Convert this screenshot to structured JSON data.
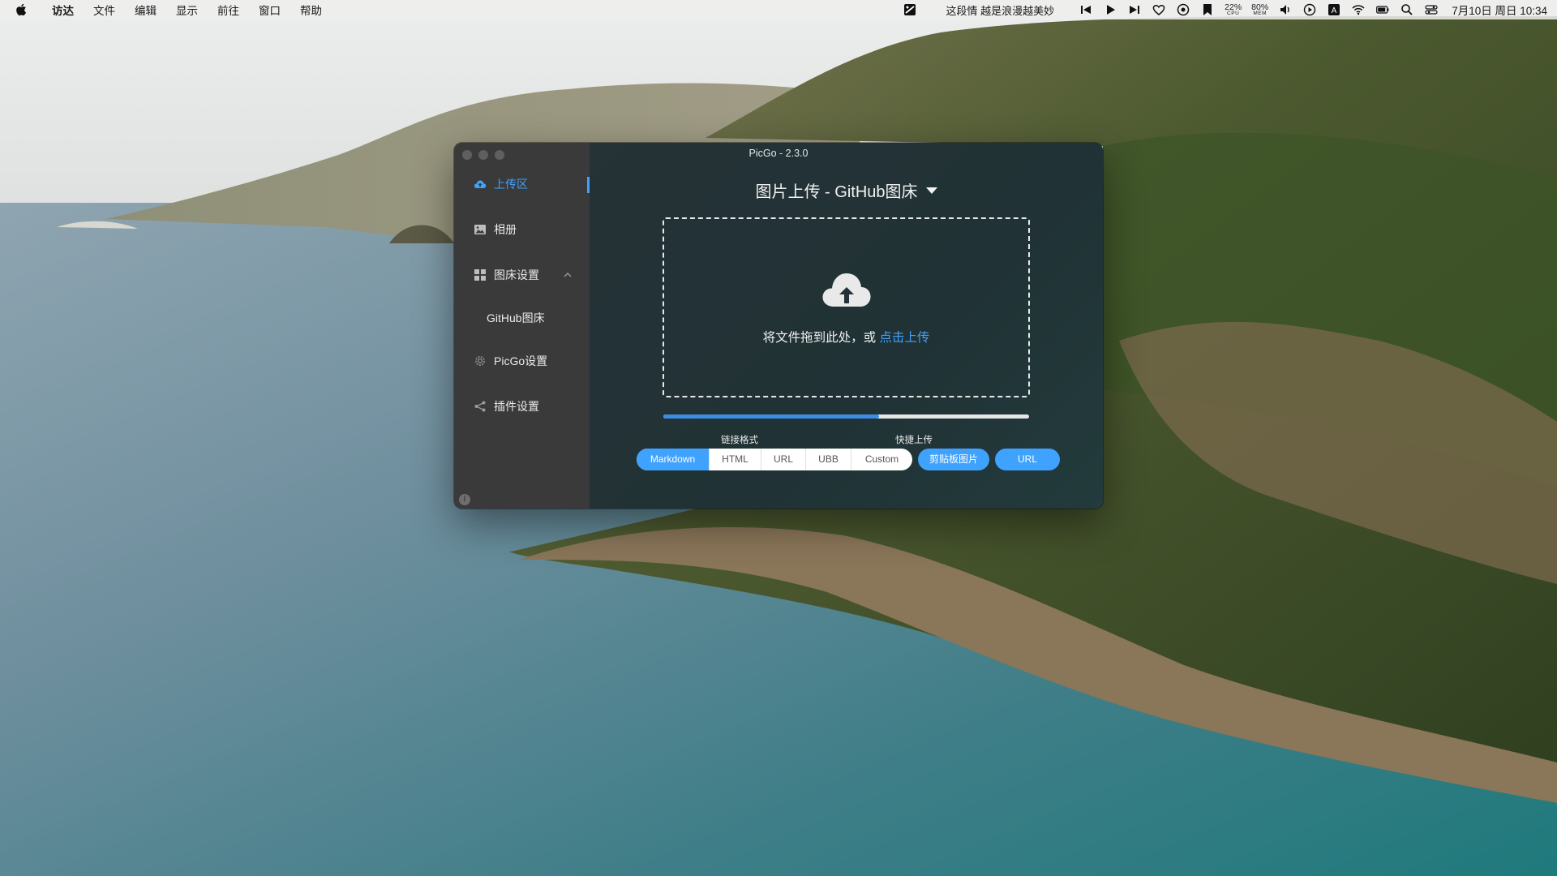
{
  "menubar": {
    "app_name": "访达",
    "menus": [
      "文件",
      "编辑",
      "显示",
      "前往",
      "窗口",
      "帮助"
    ],
    "now_playing": "这段情 越是浪漫越美妙",
    "cpu": {
      "value": "22%",
      "label": "CPU"
    },
    "mem": {
      "value": "80%",
      "label": "MEM"
    },
    "input_source": "A",
    "clock": "7月10日 周日  10:34"
  },
  "window": {
    "title": "PicGo - 2.3.0",
    "sidebar": {
      "items": [
        {
          "label": "上传区",
          "icon": "cloud-upload-icon",
          "active": true
        },
        {
          "label": "相册",
          "icon": "image-icon"
        },
        {
          "label": "图床设置",
          "icon": "grid-icon",
          "expanded": true
        },
        {
          "label": "GitHub图床"
        },
        {
          "label": "PicGo设置",
          "icon": "gear-icon"
        },
        {
          "label": "插件设置",
          "icon": "share-icon"
        }
      ]
    },
    "main": {
      "title": "图片上传 - GitHub图床",
      "drop_text": "将文件拖到此处，或 ",
      "drop_link": "点击上传",
      "progress": 0.59,
      "link_format_label": "链接格式",
      "link_formats": [
        "Markdown",
        "HTML",
        "URL",
        "UBB",
        "Custom"
      ],
      "selected_format": "Markdown",
      "quick_upload_label": "快捷上传",
      "quick_upload": [
        "剪贴板图片",
        "URL"
      ]
    }
  },
  "colors": {
    "accent": "#3fa2ff",
    "sidebar": "#3a3a3b",
    "main_bg": "#233236"
  }
}
